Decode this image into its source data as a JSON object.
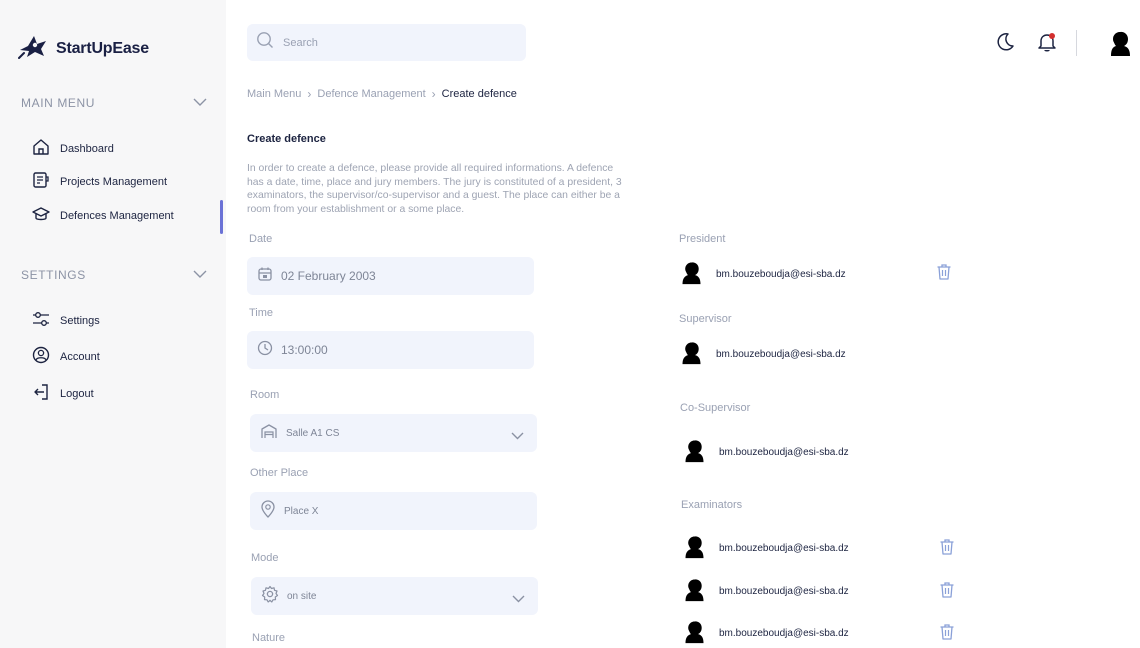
{
  "brand": {
    "name": "StartUpEase"
  },
  "sidebar": {
    "main_menu_title": "MAIN MENU",
    "main_items": [
      {
        "label": "Dashboard",
        "icon": "home-icon"
      },
      {
        "label": "Projects Management",
        "icon": "document-icon"
      },
      {
        "label": "Defences Management",
        "icon": "graduation-cap-icon"
      }
    ],
    "settings_title": "SETTINGS",
    "settings_items": [
      {
        "label": "Settings",
        "icon": "sliders-icon"
      },
      {
        "label": "Account",
        "icon": "user-circle-icon"
      },
      {
        "label": "Logout",
        "icon": "logout-icon"
      }
    ],
    "active_item": "Defences Management"
  },
  "search": {
    "placeholder": "Search"
  },
  "breadcrumb": [
    "Main Menu",
    "Defence Management",
    "Create defence"
  ],
  "page": {
    "title": "Create defence",
    "description": "In order to create a defence, please provide all required informations. A defence has a date, time, place and jury members. The jury is constituted of a president, 3 examinators, the supervisor/co-supervisor and a guest. The place can either be a room from your establishment or a some place."
  },
  "form": {
    "date_label": "Date",
    "date_value": "02 February 2003",
    "time_label": "Time",
    "time_value": "13:00:00",
    "room_label": "Room",
    "room_value": "Salle A1 CS",
    "other_place_label": "Other Place",
    "other_place_placeholder": "Place X",
    "mode_label": "Mode",
    "mode_value": "on site",
    "nature_label": "Nature"
  },
  "jury": {
    "president_label": "President",
    "president_email": "bm.bouzeboudja@esi-sba.dz",
    "supervisor_label": "Supervisor",
    "supervisor_email": "bm.bouzeboudja@esi-sba.dz",
    "cosupervisor_label": "Co-Supervisor",
    "cosupervisor_email": "bm.bouzeboudja@esi-sba.dz",
    "examinators_label": "Examinators",
    "examinators": [
      "bm.bouzeboudja@esi-sba.dz",
      "bm.bouzeboudja@esi-sba.dz",
      "bm.bouzeboudja@esi-sba.dz"
    ]
  },
  "colors": {
    "accent": "#6b72d6",
    "field_bg": "#f1f4fc",
    "sidebar_bg": "#f7f7f8",
    "notification_dot": "#d32f2f",
    "trash_icon": "#8aa0d8"
  }
}
